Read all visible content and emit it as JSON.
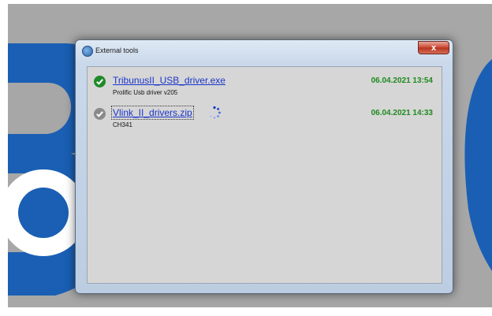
{
  "window": {
    "title": "External tools",
    "close_label": "x"
  },
  "tools": [
    {
      "name": "TribunusII_USB_driver.exe",
      "description": "Prolific Usb driver v205",
      "date": "06.04.2021 13:54",
      "status": "installed",
      "status_icon": "check-circle-icon",
      "status_color": "#1e8a2a"
    },
    {
      "name": "Vlink_II_drivers.zip",
      "description": "CH341",
      "date": "06.04.2021 14:33",
      "status": "downloading",
      "status_icon": "check-circle-icon",
      "status_color": "#8a8a8a",
      "progress_icon": "loading-spinner-icon"
    }
  ],
  "colors": {
    "link": "#1a35c9",
    "date": "#1f8a1f",
    "background_brand": "#1a5fb4"
  }
}
